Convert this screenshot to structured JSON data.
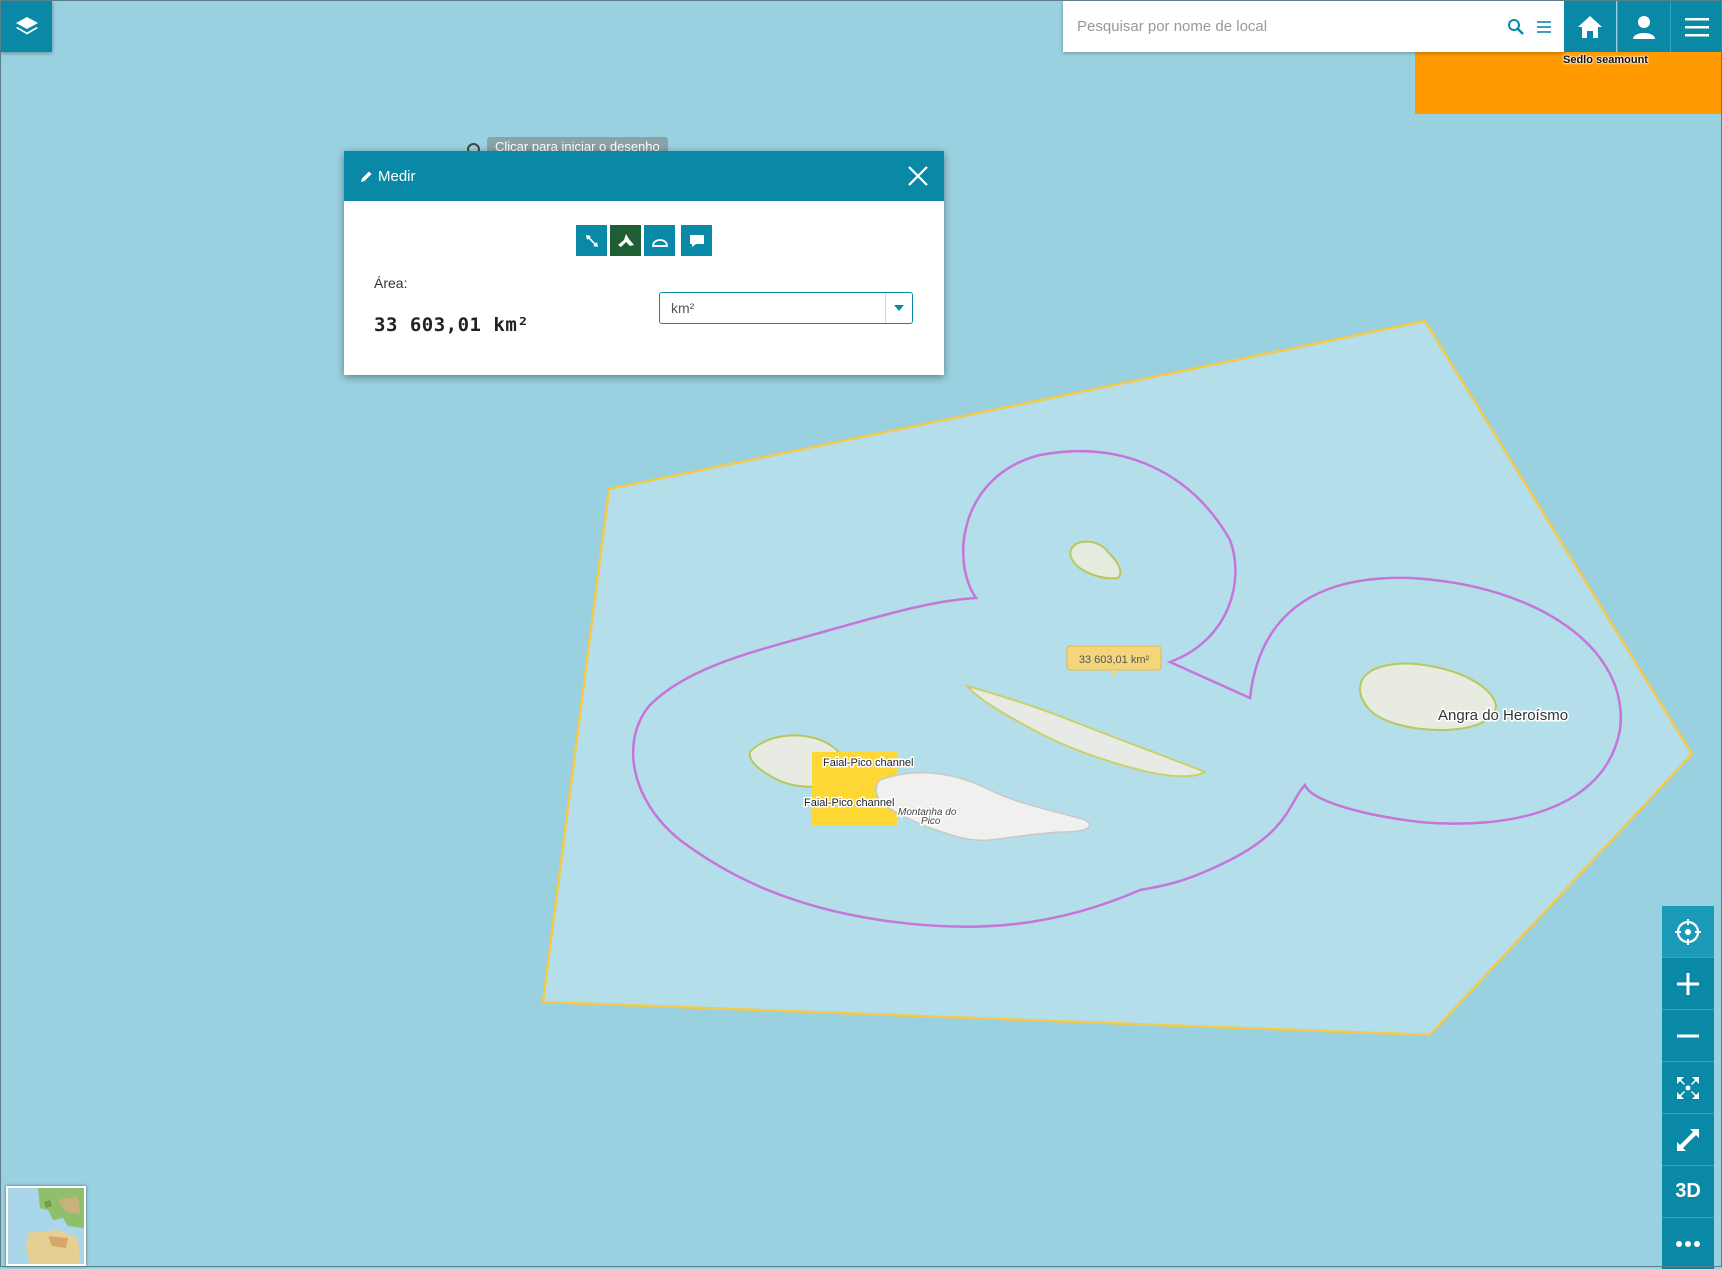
{
  "search": {
    "placeholder": "Pesquisar por nome de local"
  },
  "icons": {
    "layers": "layers-icon",
    "search": "search-icon",
    "list": "list-icon",
    "home": "home-icon",
    "user": "user-icon",
    "menu": "menu-icon",
    "close": "close-icon",
    "pencil": "pencil-icon",
    "locate": "crosshair-icon",
    "zoom_in": "plus-icon",
    "zoom_out": "minus-icon",
    "extent": "full-extent-icon",
    "fullscreen": "fullscreen-icon",
    "more": "more-icon"
  },
  "colors": {
    "accent": "#0a89a6",
    "active_tool": "#1f5e34",
    "water": "#9ad1e1",
    "measure_polygon_border": "#f5c842",
    "eez_line": "#c060d0",
    "orange_area": "#ff9a00",
    "channel_highlight": "#fdd835"
  },
  "draw_hint": "Clicar para iniciar o desenho",
  "measure": {
    "title": "Medir",
    "area_label": "Área:",
    "area_value": "33 603,01 km²",
    "unit": "km²",
    "tools": [
      "distance",
      "area",
      "angle",
      "annotation"
    ]
  },
  "map": {
    "labels": {
      "sedlo": "Sedlo seamount",
      "angra": "Angra do Heroísmo",
      "channel_1": "Faial-Pico channel",
      "channel_2": "Faial-Pico channel",
      "montanha_1": "Montanha do",
      "montanha_2": "Pico",
      "area_tooltip": "33 603,01 km²"
    }
  },
  "controls": {
    "three_d": "3D"
  }
}
